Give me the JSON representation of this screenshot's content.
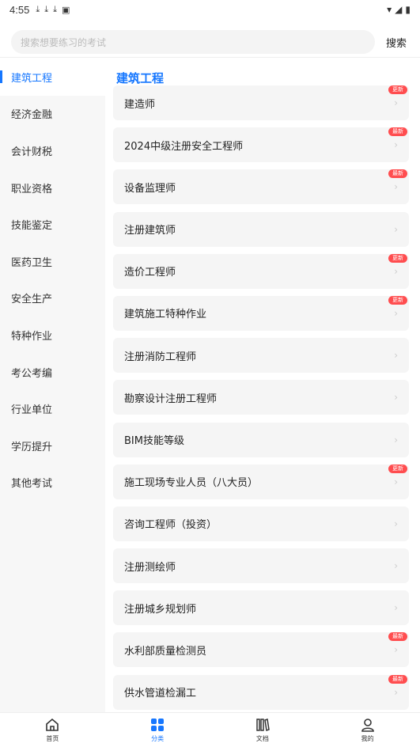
{
  "status_bar": {
    "time": "4:55",
    "icons": [
      "download-icon",
      "download-icon",
      "download-icon",
      "a-icon"
    ],
    "right_icons": [
      "wifi-icon",
      "signal-icon",
      "battery-icon"
    ]
  },
  "search": {
    "placeholder": "搜索想要练习的考试",
    "button": "搜索"
  },
  "sidebar": {
    "items": [
      {
        "label": "建筑工程"
      },
      {
        "label": "经济金融"
      },
      {
        "label": "会计财税"
      },
      {
        "label": "职业资格"
      },
      {
        "label": "技能鉴定"
      },
      {
        "label": "医药卫生"
      },
      {
        "label": "安全生产"
      },
      {
        "label": "特种作业"
      },
      {
        "label": "考公考编"
      },
      {
        "label": "行业单位"
      },
      {
        "label": "学历提升"
      },
      {
        "label": "其他考试"
      }
    ]
  },
  "main": {
    "section_title": "建筑工程",
    "items": [
      {
        "label": "建造师",
        "badge": "更新"
      },
      {
        "label": "2024中级注册安全工程师",
        "badge": "最新"
      },
      {
        "label": "设备监理师",
        "badge": "最新"
      },
      {
        "label": "注册建筑师",
        "badge": ""
      },
      {
        "label": "造价工程师",
        "badge": "更新"
      },
      {
        "label": "建筑施工特种作业",
        "badge": "更新"
      },
      {
        "label": "注册消防工程师",
        "badge": ""
      },
      {
        "label": "勘察设计注册工程师",
        "badge": ""
      },
      {
        "label": "BIM技能等级",
        "badge": ""
      },
      {
        "label": "施工现场专业人员（八大员）",
        "badge": "更新"
      },
      {
        "label": "咨询工程师（投资）",
        "badge": ""
      },
      {
        "label": "注册测绘师",
        "badge": ""
      },
      {
        "label": "注册城乡规划师",
        "badge": ""
      },
      {
        "label": "水利部质量检测员",
        "badge": "最新"
      },
      {
        "label": "供水管道检漏工",
        "badge": "最新"
      }
    ],
    "chevron": "›"
  },
  "bottom_nav": {
    "tabs": [
      {
        "label": "首页",
        "icon": "home-icon"
      },
      {
        "label": "分类",
        "icon": "category-icon"
      },
      {
        "label": "文档",
        "icon": "books-icon"
      },
      {
        "label": "我的",
        "icon": "user-icon"
      }
    ],
    "active_color": "#1677ff"
  }
}
